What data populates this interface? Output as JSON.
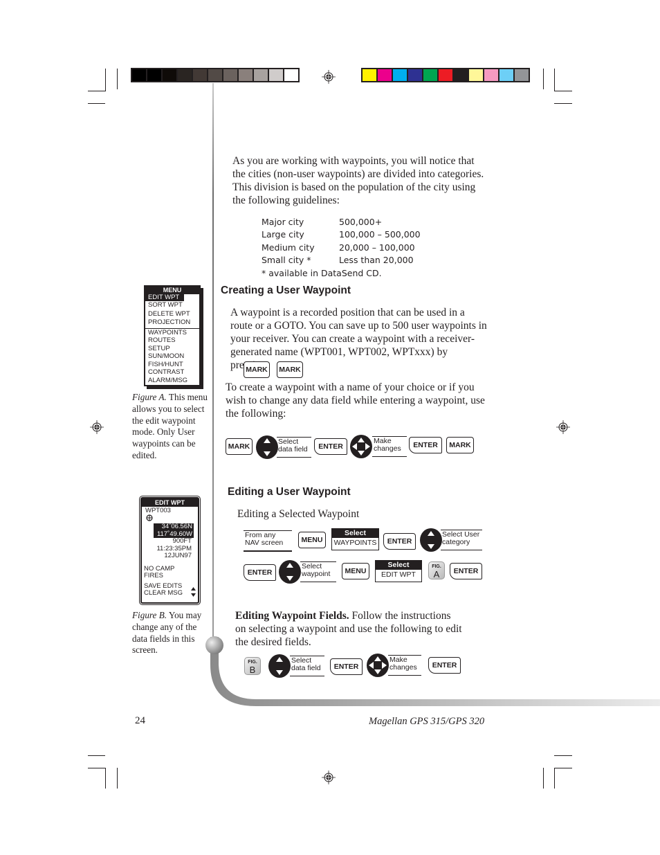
{
  "print_marks": {
    "grayscale_swatches": [
      "#000000",
      "#000000",
      "#0f0b08",
      "#2a2522",
      "#423935",
      "#524a46",
      "#6b625e",
      "#8a807c",
      "#a8a29f",
      "#d0cccb",
      "#ffffff"
    ],
    "color_swatches": [
      "#fff200",
      "#ec008c",
      "#00aeef",
      "#2e3192",
      "#00a651",
      "#ed1c24",
      "#231f20",
      "#fff799",
      "#f49ac1",
      "#6dcff6",
      "#939598"
    ]
  },
  "intro": {
    "paragraph": "As you are working with waypoints, you will notice that the cities (non-user waypoints) are divided into categories.  This division is based on the population of the city using the following guidelines:",
    "guidelines": [
      {
        "category": "Major city",
        "population": "500,000+"
      },
      {
        "category": "Large city",
        "population": "100,000 – 500,000"
      },
      {
        "category": "Medium city",
        "population": "20,000 – 100,000"
      },
      {
        "category": "Small city *",
        "population": "Less than 20,000"
      }
    ],
    "footnote": "* available in DataSend CD."
  },
  "creating": {
    "heading": "Creating a User Waypoint",
    "paragraph1": "A waypoint is a recorded position that can be used in a route or a GOTO.  You can save up to 500 user waypoints in your receiver.  You can create a waypoint with a receiver-generated name (WPT001, WPT002, WPTxxx) by pressing:",
    "quick_keys": [
      "MARK",
      "MARK"
    ],
    "paragraph2": "To create a waypoint with a name of your choice or if you wish to change any data field while entering a waypoint, use the following:",
    "sequence": {
      "key1": "MARK",
      "step1_label": [
        "Select",
        "data field"
      ],
      "key2": "ENTER",
      "step2_label": [
        "Make",
        "changes"
      ],
      "key3": "ENTER",
      "key4": "MARK"
    }
  },
  "editing": {
    "heading": "Editing a User Waypoint",
    "subheading": "Editing a Selected Waypoint",
    "row1": {
      "start_label": [
        "From any",
        "NAV screen"
      ],
      "key1": "MENU",
      "select1_header": "Select",
      "select1_value": "WAYPOINTS",
      "key2": "ENTER",
      "step_label": [
        "Select User",
        "category"
      ]
    },
    "row2": {
      "key1": "ENTER",
      "step_label": [
        "Select",
        "waypoint"
      ],
      "key2": "MENU",
      "select_header": "Select",
      "select_value": "EDIT WPT",
      "fig_tag": "FIG.",
      "fig_letter": "A",
      "key3": "ENTER"
    },
    "fields_lead": "Editing Waypoint Fields.",
    "fields_text": "  Follow the instructions on selecting a waypoint and use the following to edit the desired fields.",
    "row3": {
      "fig_tag": "FIG.",
      "fig_letter": "B",
      "step1_label": [
        "Select",
        "data field"
      ],
      "key1": "ENTER",
      "step2_label": [
        "Make",
        "changes"
      ],
      "key2": "ENTER"
    }
  },
  "figure_a": {
    "title": "MENU",
    "selected": "EDIT WPT",
    "group1": [
      "SORT WPT",
      "DELETE WPT",
      "PROJECTION"
    ],
    "group2": [
      "WAYPOINTS",
      "ROUTES",
      "SETUP",
      "SUN/MOON",
      "FISH/HUNT",
      "CONTRAST",
      "ALARM/MSG"
    ],
    "caption_label": "Figure A.",
    "caption_text": " This menu allows you to select the edit waypoint mode.  Only User waypoints can be edited."
  },
  "figure_b": {
    "title": "EDIT WPT",
    "name": "WPT003",
    "lat": "34˚06.56N",
    "lon": "117˚49.60W",
    "altitude": "900FT",
    "time": "11:23:35PM",
    "date": "12JUN97",
    "message": [
      "NO CAMP",
      "FIRES"
    ],
    "actions": [
      "SAVE EDITS",
      "CLEAR MSG"
    ],
    "caption_label": "Figure B.",
    "caption_text": "  You may change any of the data fields in this screen."
  },
  "footer": {
    "page_number": "24",
    "book_title": "Magellan GPS 315/GPS 320"
  }
}
